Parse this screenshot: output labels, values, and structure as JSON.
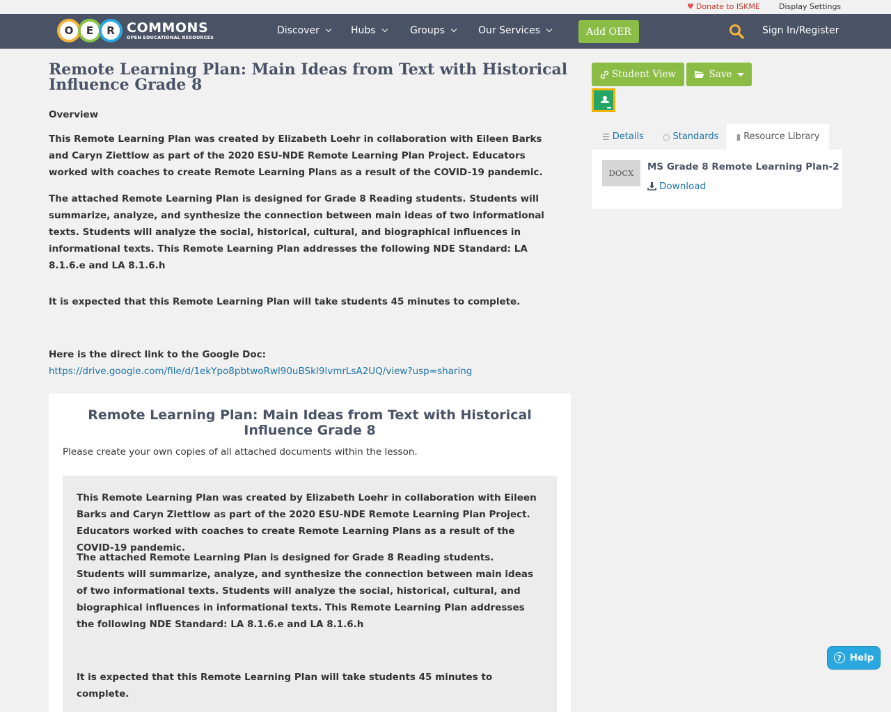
{
  "utility": {
    "donate": "Donate to ISKME",
    "display_settings": "Display Settings"
  },
  "nav": {
    "logo_letters": [
      "O",
      "E",
      "R"
    ],
    "logo_main": "COMMONS",
    "logo_sub": "OPEN EDUCATIONAL RESOURCES",
    "items": [
      "Discover",
      "Hubs",
      "Groups",
      "Our Services"
    ],
    "add_oer": "Add OER",
    "sign_in": "Sign In/Register"
  },
  "main": {
    "title": "Remote Learning Plan: Main Ideas from Text with Historical Influence Grade 8",
    "overview_label": "Overview",
    "para1": "This Remote Learning Plan was created by Elizabeth Loehr in collaboration with Eileen Barks and Caryn Ziettlow as part of the 2020 ESU-NDE Remote Learning Plan Project. Educators worked with coaches to create Remote Learning Plans as a result of the COVID-19 pandemic.",
    "para2": "The attached Remote Learning Plan is designed for Grade 8 Reading students. Students will summarize, analyze, and synthesize the connection between main ideas of two informational texts. Students will analyze the social, historical, cultural, and biographical influences in informational texts. This Remote Learning Plan addresses the following NDE Standard: LA 8.1.6.e and LA 8.1.6.h",
    "para3": "It is expected that this Remote Learning Plan will take students 45  minutes to complete.",
    "link_intro": "Here is the direct link to the Google Doc:",
    "link_url": "https://drive.google.com/file/d/1ekYpo8pbtwoRwl90uBSkI9lvmrLsA2UQ/view?usp=sharing"
  },
  "lesson": {
    "title": "Remote Learning Plan: Main Ideas from Text with Historical Influence Grade 8",
    "note": "Please create your own copies of all attached documents within the lesson.",
    "para1": "This Remote Learning Plan was created by Elizabeth Loehr in collaboration with Eileen Barks and Caryn Ziettlow as part of the 2020 ESU-NDE Remote Learning Plan Project. Educators worked with coaches to create Remote Learning Plans as a result of the COVID-19 pandemic.",
    "para2": "The attached Remote Learning Plan is designed for Grade 8 Reading students. Students will summarize, analyze, and synthesize the connection between main ideas of two informational texts. Students will analyze the social, historical, cultural, and biographical influences in informational texts. This Remote Learning Plan addresses the following NDE Standard: LA 8.1.6.e and LA 8.1.6.h",
    "para3": "It is expected that this Remote Learning Plan will take students 45  minutes to complete."
  },
  "sidebar": {
    "student_view": "Student View",
    "save": "Save",
    "tabs": {
      "details": "Details",
      "standards": "Standards",
      "library": "Resource Library"
    },
    "file": {
      "badge": "DOCX",
      "name": "MS Grade 8 Remote Learning Plan-2",
      "download": "Download"
    }
  },
  "help": {
    "label": "Help"
  },
  "colors": {
    "nav_bg": "#4a5366",
    "accent_green": "#8bbd46",
    "link_blue": "#1a73a8",
    "help_blue": "#29a8e0"
  }
}
